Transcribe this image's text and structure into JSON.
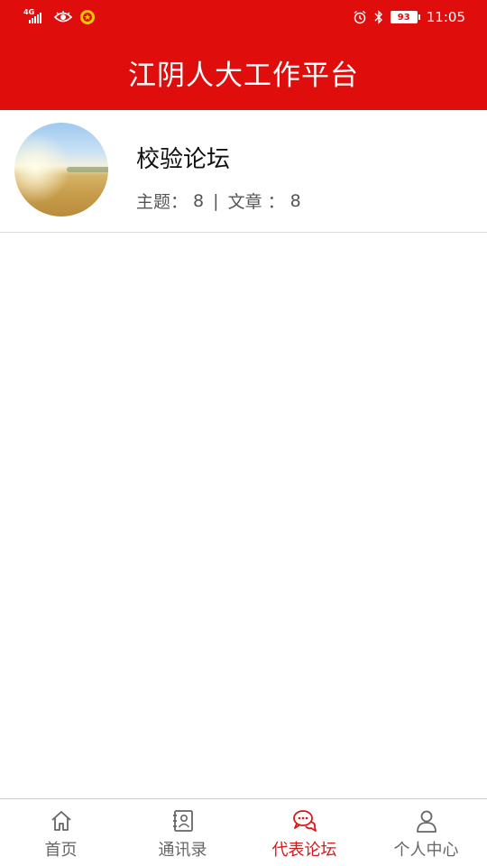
{
  "status_bar": {
    "network": "4G",
    "battery": "93",
    "time": "11:05"
  },
  "header": {
    "title": "江阴人大工作平台"
  },
  "forums": [
    {
      "name": "校验论坛",
      "topics_label": "主题：",
      "topics": "8",
      "articles_label": "文章 ：",
      "articles": "8"
    }
  ],
  "bottom_nav": {
    "items": [
      {
        "label": "首页",
        "icon": "home-icon",
        "active": false
      },
      {
        "label": "通讯录",
        "icon": "contacts-icon",
        "active": false
      },
      {
        "label": "代表论坛",
        "icon": "chat-bubbles-icon",
        "active": true
      },
      {
        "label": "个人中心",
        "icon": "person-icon",
        "active": false
      }
    ]
  },
  "colors": {
    "brand_red": "#e00d0d",
    "active_nav": "#d61a1a",
    "inactive_nav": "#666666"
  }
}
